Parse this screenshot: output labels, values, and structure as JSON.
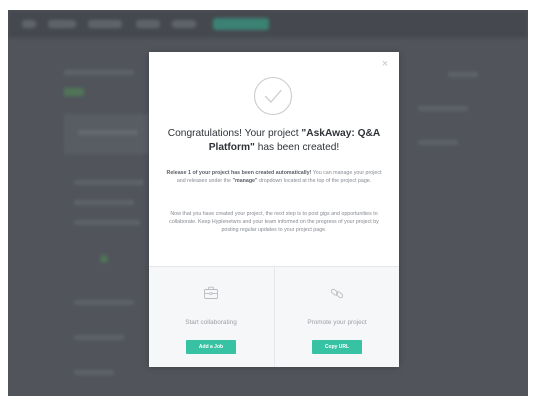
{
  "modal": {
    "close_symbol": "×",
    "title_prefix": "Congratulations! Your project ",
    "project_name": "\"AskAway: Q&A Platform\"",
    "title_suffix": " has been created!",
    "body1_strong": "Release 1 of your project has been created automatically!",
    "body1_text_a": " You can manage your project and releases under the ",
    "body1_manage": "\"manage\"",
    "body1_text_b": " dropdown located at the top of the project page.",
    "body2": "Now that you have created your project, the next step is to post gigs and opportunities to collaborate. Keep Hyplenetwrs and your team informed on the progress of your project by posting regular updates to your project page.",
    "actions": [
      {
        "label": "Start collaborating",
        "button": "Add a Job",
        "icon": "briefcase-icon"
      },
      {
        "label": "Promote your project",
        "button": "Copy URL",
        "icon": "link-icon"
      }
    ]
  },
  "colors": {
    "accent": "#37c2a3",
    "overlay": "#51555b",
    "title": "#2f3338",
    "muted": "#858a91"
  }
}
